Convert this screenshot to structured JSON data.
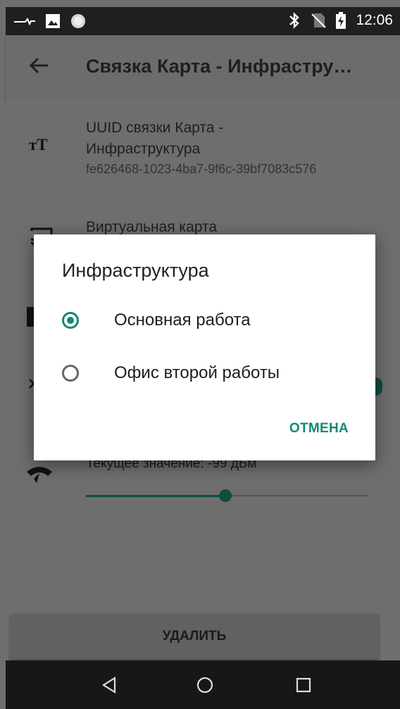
{
  "status_bar": {
    "time": "12:06",
    "icons": [
      "signal-icon",
      "image-icon",
      "circle-icon",
      "bluetooth-icon",
      "no-sim-icon",
      "battery-charging-icon"
    ]
  },
  "app_bar": {
    "title": "Связка Карта - Инфрастру…",
    "back_icon": "arrow-back-icon"
  },
  "settings": {
    "uuid_title": "UUID связки Карта - Инфраструктура",
    "uuid_title_line1": "UUID связки Карта -",
    "uuid_title_line2": "Инфраструктура",
    "uuid_value": "fe626468-1023-4ba7-9f6c-39bf7083c576",
    "virtual_card_title": "Виртуальная карта",
    "signal_value_text": "Текущее значение: -99 дБм",
    "slider_fraction": 0.5
  },
  "dialog": {
    "title": "Инфраструктура",
    "options": [
      {
        "label": "Основная работа",
        "selected": true
      },
      {
        "label": "Офис второй работы",
        "selected": false
      }
    ],
    "cancel_label": "ОТМЕНА"
  },
  "delete_button": {
    "label": "УДАЛИТЬ"
  },
  "nav_bar": {
    "icons": [
      "back-triangle-icon",
      "home-circle-icon",
      "recents-square-icon"
    ]
  },
  "colors": {
    "accent": "#14866f",
    "dialog_bg": "#ffffff",
    "scrim": "#6e6e6e"
  }
}
